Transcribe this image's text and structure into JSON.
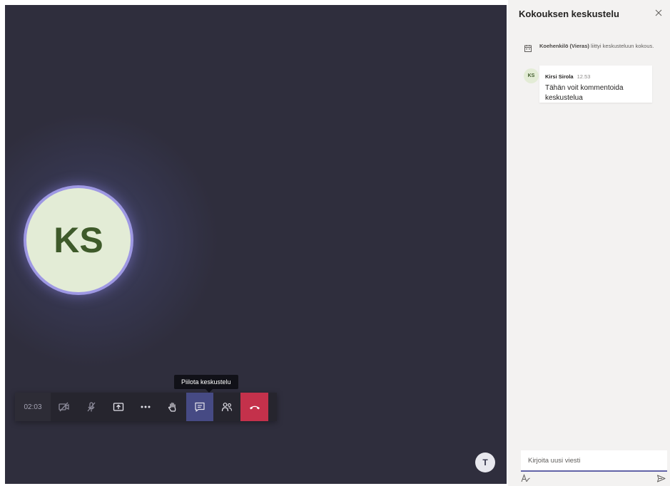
{
  "call": {
    "participant_initials": "KS",
    "timer": "02:03",
    "tooltip": "Piilota keskustelu",
    "self_initial": "T"
  },
  "toolbar": {
    "buttons": [
      {
        "name": "camera-off",
        "icon": "video-off-icon"
      },
      {
        "name": "mic-muted",
        "icon": "mic-off-icon"
      },
      {
        "name": "share",
        "icon": "share-screen-icon"
      },
      {
        "name": "more",
        "icon": "more-icon"
      },
      {
        "name": "raise-hand",
        "icon": "hand-icon"
      },
      {
        "name": "chat",
        "icon": "chat-icon",
        "active": true
      },
      {
        "name": "participants",
        "icon": "people-icon"
      },
      {
        "name": "hang-up",
        "icon": "hangup-icon"
      }
    ],
    "active_color": "#464a84",
    "hangup_color": "#c4314b"
  },
  "chat": {
    "title": "Kokouksen keskustelu",
    "system_message": {
      "name": "Koehenkilö (Vieras)",
      "text": "liittyi keskusteluun kokous."
    },
    "messages": [
      {
        "avatar": "KS",
        "author": "Kirsi Sirola",
        "time": "12.53",
        "text": "Tähän voit kommentoida keskustelua"
      }
    ],
    "compose_placeholder": "Kirjoita uusi viesti",
    "accent_color": "#6264a7"
  }
}
